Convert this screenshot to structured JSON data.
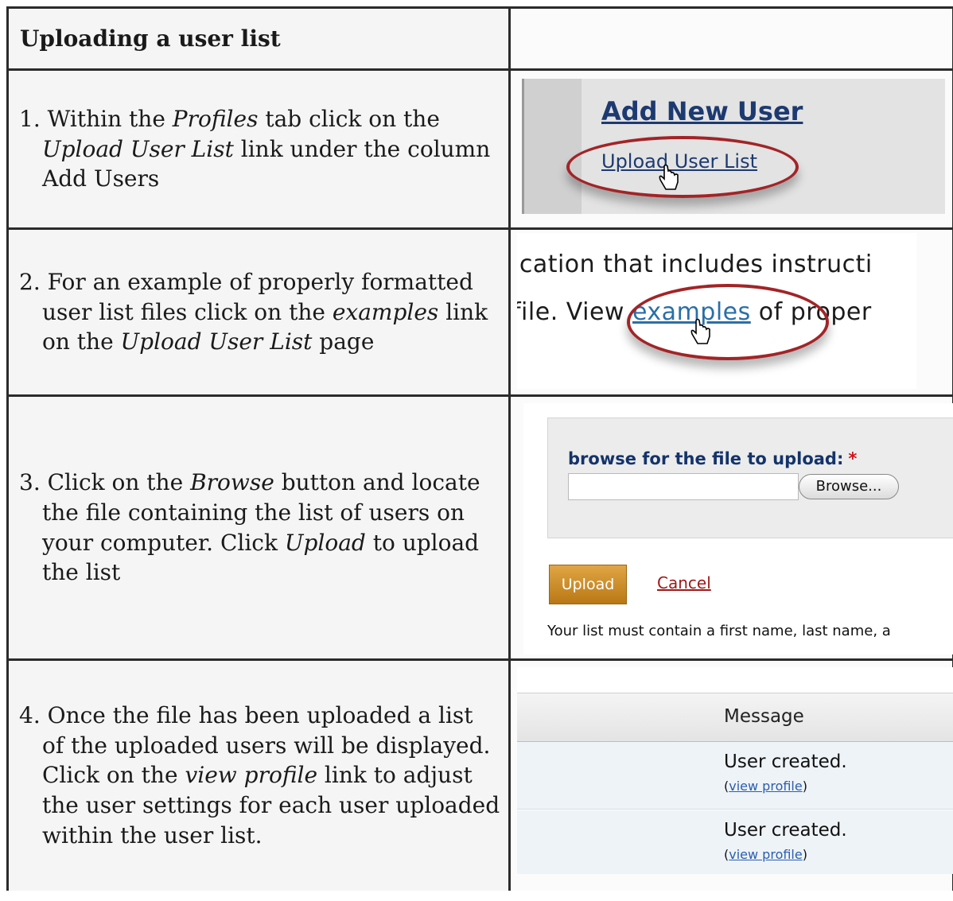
{
  "title": "Uploading a user list",
  "steps": [
    {
      "num": "1.",
      "t1": " Within the ",
      "i1": "Profiles",
      "t2": " tab click on the ",
      "i2": "Upload User List",
      "t3": " link under the column Add Users"
    },
    {
      "num": "2.",
      "t1": " For an example of properly formatted user list files click on the ",
      "i1": "examples",
      "t2": " link on the ",
      "i2": "Upload User List",
      "t3": " page"
    },
    {
      "num": "3.",
      "t1": " Click on the ",
      "i1": "Browse",
      "t2": " button and locate the file containing the list of users on your computer. Click ",
      "i2": "Upload",
      "t3": " to upload the list"
    },
    {
      "num": "4.",
      "t1": " Once the file has been uploaded a list of the uploaded users will be displayed. Click on the ",
      "i1": "view profile",
      "t2": " link to adjust the user settings for each user uploaded within the user list."
    }
  ],
  "shot1": {
    "heading": "Add New User",
    "link": "Upload User List"
  },
  "shot2": {
    "line1": "ication that includes instructi",
    "line2_pre": "file. View ",
    "link": "examples",
    "line2_post": " of proper"
  },
  "shot3": {
    "label": "browse for the file to upload:",
    "required_mark": "*",
    "browse_button": "Browse...",
    "upload_button": "Upload",
    "cancel_link": "Cancel",
    "note": "Your list must contain a first name, last name, a"
  },
  "shot4": {
    "header": "Message",
    "rows": [
      {
        "message": "User created.",
        "open": "(",
        "link": "view profile",
        "close": ")"
      },
      {
        "message": "User created.",
        "open": "(",
        "link": "view profile",
        "close": ")"
      }
    ]
  },
  "colors": {
    "ellipse": "#a22427",
    "link_blue": "#1d3a70",
    "upload_orange": "#c98a22"
  }
}
